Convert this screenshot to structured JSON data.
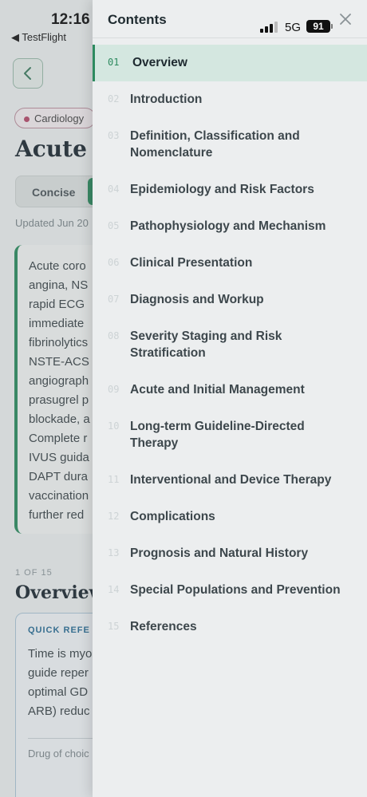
{
  "status_bar": {
    "time": "12:16",
    "back_app": "◀ TestFlight",
    "network": "5G",
    "battery": "91"
  },
  "background": {
    "back_icon": "chevron-left-icon",
    "tag": "Cardiology",
    "title": "Acute C",
    "tabs": {
      "concise": "Concise"
    },
    "updated": "Updated Jun 20",
    "summary_lines": "Acute coro\nangina, NS\nrapid ECG\nimmediate\nfibrinolytics\nNSTE-ACS\nangiograph\nprasugrel p\nblockade, a\nComplete r\nIVUS guida\nDAPT dura\nvaccination\nfurther red",
    "section_index": "1 OF 15",
    "section_title": "Overview",
    "quick_ref_label": "QUICK REFE",
    "quick_ref_text": "Time is myo\nguide reper\noptimal GD\nARB) reduc",
    "drug_label": "Drug of choic"
  },
  "drawer": {
    "title": "Contents",
    "close_icon": "close-icon",
    "items": [
      {
        "num": "01",
        "label": "Overview",
        "active": true
      },
      {
        "num": "02",
        "label": "Introduction"
      },
      {
        "num": "03",
        "label": "Definition, Classification and Nomenclature"
      },
      {
        "num": "04",
        "label": "Epidemiology and Risk Factors"
      },
      {
        "num": "05",
        "label": "Pathophysiology and Mechanism"
      },
      {
        "num": "06",
        "label": "Clinical Presentation"
      },
      {
        "num": "07",
        "label": "Diagnosis and Workup"
      },
      {
        "num": "08",
        "label": "Severity Staging and Risk Stratification"
      },
      {
        "num": "09",
        "label": "Acute and Initial Management"
      },
      {
        "num": "10",
        "label": "Long-term Guideline-Directed Therapy"
      },
      {
        "num": "11",
        "label": "Interventional and Device Therapy"
      },
      {
        "num": "12",
        "label": "Complications"
      },
      {
        "num": "13",
        "label": "Prognosis and Natural History"
      },
      {
        "num": "14",
        "label": "Special Populations and Prevention"
      },
      {
        "num": "15",
        "label": "References"
      }
    ]
  },
  "colors": {
    "accent": "#2d8a5f",
    "active_bg": "#d4e7e0",
    "tag_dot": "#b34a6a"
  }
}
